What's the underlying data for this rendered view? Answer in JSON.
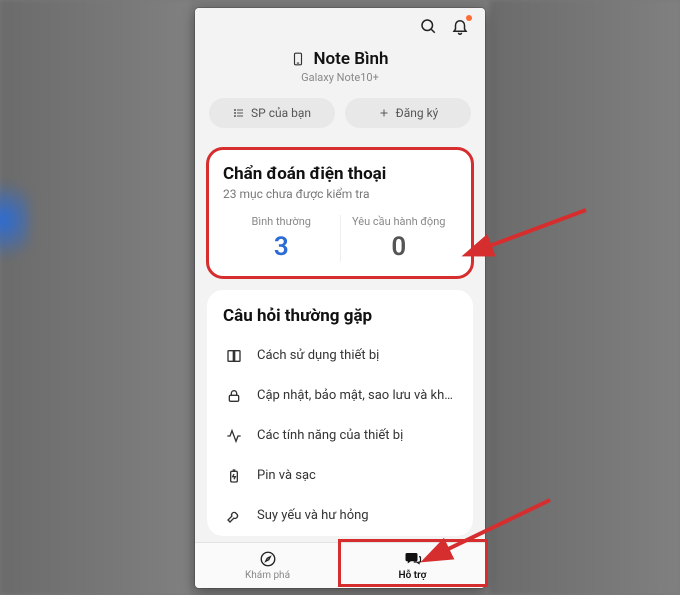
{
  "topbar": {
    "search_icon": "search",
    "bell_icon": "bell"
  },
  "device": {
    "name": "Note               Bình",
    "model": "Galaxy Note10+"
  },
  "pills": {
    "products": "SP của bạn",
    "register": "Đăng ký"
  },
  "diagnosis": {
    "title": "Chẩn đoán điện thoại",
    "subtitle": "23 mục chưa được kiểm tra",
    "normal_label": "Bình thường",
    "normal_value": "3",
    "action_label": "Yêu cầu hành động",
    "action_value": "0"
  },
  "faq": {
    "title": "Câu hỏi thường gặp",
    "items": [
      {
        "label": "Cách sử dụng thiết bị"
      },
      {
        "label": "Cập nhật, bảo mật, sao lưu và khôi phục"
      },
      {
        "label": "Các tính năng của thiết bị"
      },
      {
        "label": "Pin và sạc"
      },
      {
        "label": "Suy yếu và hư hỏng"
      }
    ]
  },
  "nav": {
    "explore": "Khám phá",
    "support": "Hỗ trợ"
  }
}
